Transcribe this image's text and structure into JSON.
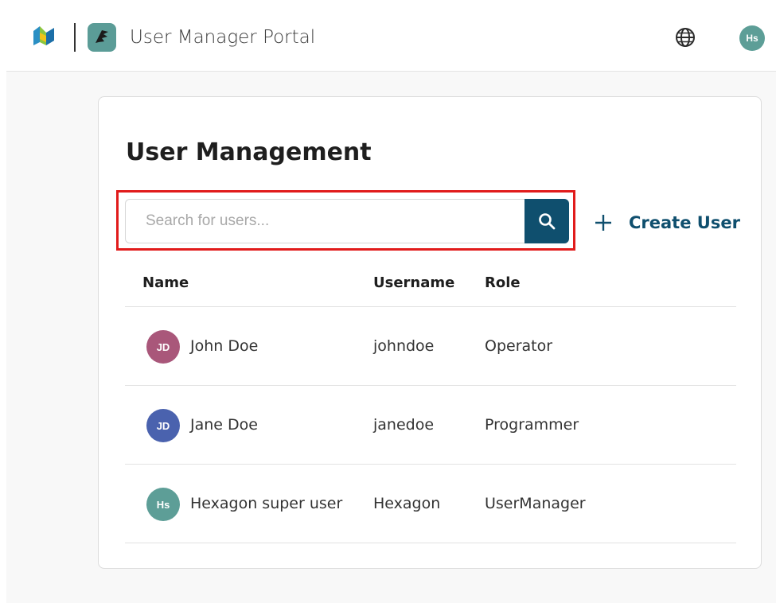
{
  "header": {
    "title": "User Manager Portal",
    "avatar_initials": "Hs",
    "brand_icon": "hexagon-logo-icon",
    "app_icon": "app-logo-icon",
    "globe_icon": "globe-icon"
  },
  "page": {
    "title": "User Management"
  },
  "search": {
    "placeholder": "Search for users...",
    "value": "",
    "button_icon": "search-icon"
  },
  "actions": {
    "create_user_label": "Create User",
    "create_user_icon": "plus-icon"
  },
  "table": {
    "columns": [
      "Name",
      "Username",
      "Role"
    ],
    "rows": [
      {
        "initials": "JD",
        "avatar_color": "#a9577a",
        "name": "John Doe",
        "username": "johndoe",
        "role": "Operator"
      },
      {
        "initials": "JD",
        "avatar_color": "#4a62ae",
        "name": "Jane Doe",
        "username": "janedoe",
        "role": "Programmer"
      },
      {
        "initials": "Hs",
        "avatar_color": "#5d9e97",
        "name": "Hexagon super user",
        "username": "Hexagon",
        "role": "UserManager"
      }
    ]
  },
  "colors": {
    "accent": "#0f4f6e",
    "highlight_border": "#e11b1b",
    "app_logo_bg": "#5b9c97"
  }
}
